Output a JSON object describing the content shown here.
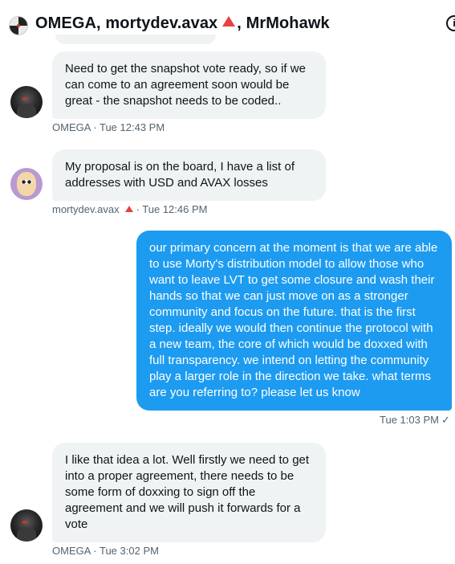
{
  "header": {
    "name_a": "OMEGA, mortydev.avax",
    "name_b": ", MrMohawk"
  },
  "messages": [
    {
      "sender": "OMEGA",
      "text": "Need to get the snapshot vote ready, so if we can come to an agreement soon would be great - the snapshot needs to be coded..",
      "meta": "OMEGA · Tue 12:43 PM"
    },
    {
      "sender": "mortydev.avax",
      "text": "My proposal is on the board, I have a list of addresses with USD and AVAX losses",
      "meta_name": "mortydev.avax",
      "meta_time": "· Tue 12:46 PM"
    },
    {
      "sender": "me",
      "text": "our primary concern at the moment is that we are able to use Morty's distribution model to allow those who want to leave LVT to get some closure and wash their hands so that we can just move on as a stronger community and focus on the future. that is the first step. ideally we would then continue the protocol with a new team, the core of which would be doxxed with full transparency. we intend on letting the community play a larger role in the direction we take. what terms are you referring to? please let us know",
      "meta": "Tue 1:03 PM",
      "status": "✓"
    },
    {
      "sender": "OMEGA",
      "text": "I like that idea a lot. Well firstly we need to get into a proper agreement, there needs to be some form of doxxing to sign off the agreement and we will push it forwards for a vote",
      "meta": "OMEGA · Tue 3:02 PM"
    }
  ],
  "colors": {
    "accent": "#1d9bf0",
    "incoming_bubble": "#eff3f4",
    "avax_red": "#e84142",
    "meta_text": "#536471"
  },
  "icons": {
    "info": "info-icon",
    "avax": "avax-triangle-icon",
    "sent": "check-icon"
  }
}
